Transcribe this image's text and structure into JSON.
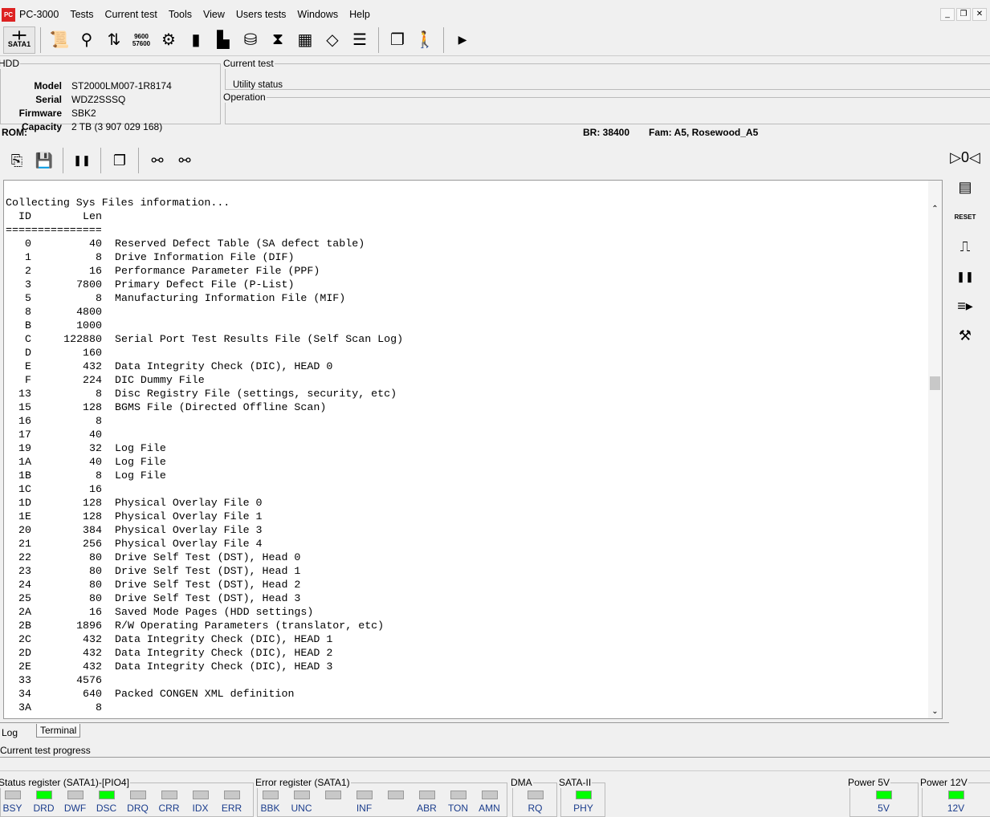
{
  "app": {
    "title": "PC-3000",
    "menu": [
      "PC-3000",
      "Tests",
      "Current test",
      "Tools",
      "View",
      "Users tests",
      "Windows",
      "Help"
    ]
  },
  "toolbar": {
    "sata_label": "SATA1",
    "icons": [
      "info-scroll-icon",
      "lightbulb-icon",
      "transfer-icon",
      "baud-rate-icon",
      "gear-disk-icon",
      "chip-icon",
      "board-icon",
      "cylinder-icon",
      "hourglass-icon",
      "grid-icon",
      "flowchart-icon",
      "list-icon",
      "windows-icon",
      "exit-icon",
      "more-icon"
    ],
    "baud_text": "9600 57600"
  },
  "hdd": {
    "legend": "HDD",
    "fields": [
      {
        "key": "Model",
        "value": "ST2000LM007-1R8174"
      },
      {
        "key": "Serial",
        "value": "WDZ2SSSQ"
      },
      {
        "key": "Firmware",
        "value": "SBK2"
      },
      {
        "key": "Capacity",
        "value": "2 TB (3 907 029 168)"
      }
    ]
  },
  "current_test": {
    "legend": "Current test",
    "status": "Utility status"
  },
  "operation": {
    "legend": "Operation"
  },
  "rom": {
    "label": "ROM:",
    "br": "BR: 38400",
    "fam": "Fam: A5, Rosewood_A5"
  },
  "log": {
    "header": "Collecting Sys Files information...",
    "col_id": "ID",
    "col_len": "Len",
    "separator": "===============",
    "rows": [
      {
        "id": "0",
        "len": "40",
        "desc": "Reserved Defect Table (SA defect table)"
      },
      {
        "id": "1",
        "len": "8",
        "desc": "Drive Information File (DIF)"
      },
      {
        "id": "2",
        "len": "16",
        "desc": "Performance Parameter File (PPF)"
      },
      {
        "id": "3",
        "len": "7800",
        "desc": "Primary Defect File (P-List)"
      },
      {
        "id": "5",
        "len": "8",
        "desc": "Manufacturing Information File (MIF)"
      },
      {
        "id": "8",
        "len": "4800",
        "desc": ""
      },
      {
        "id": "B",
        "len": "1000",
        "desc": ""
      },
      {
        "id": "C",
        "len": "122880",
        "desc": "Serial Port Test Results File (Self Scan Log)"
      },
      {
        "id": "D",
        "len": "160",
        "desc": ""
      },
      {
        "id": "E",
        "len": "432",
        "desc": "Data Integrity Check (DIC), HEAD 0"
      },
      {
        "id": "F",
        "len": "224",
        "desc": "DIC Dummy File"
      },
      {
        "id": "13",
        "len": "8",
        "desc": "Disc Registry File (settings, security, etc)"
      },
      {
        "id": "15",
        "len": "128",
        "desc": "BGMS File (Directed Offline Scan)"
      },
      {
        "id": "16",
        "len": "8",
        "desc": ""
      },
      {
        "id": "17",
        "len": "40",
        "desc": ""
      },
      {
        "id": "19",
        "len": "32",
        "desc": "Log File"
      },
      {
        "id": "1A",
        "len": "40",
        "desc": "Log File"
      },
      {
        "id": "1B",
        "len": "8",
        "desc": "Log File"
      },
      {
        "id": "1C",
        "len": "16",
        "desc": ""
      },
      {
        "id": "1D",
        "len": "128",
        "desc": "Physical Overlay File 0"
      },
      {
        "id": "1E",
        "len": "128",
        "desc": "Physical Overlay File 1"
      },
      {
        "id": "20",
        "len": "384",
        "desc": "Physical Overlay File 3"
      },
      {
        "id": "21",
        "len": "256",
        "desc": "Physical Overlay File 4"
      },
      {
        "id": "22",
        "len": "80",
        "desc": "Drive Self Test (DST), Head 0"
      },
      {
        "id": "23",
        "len": "80",
        "desc": "Drive Self Test (DST), Head 1"
      },
      {
        "id": "24",
        "len": "80",
        "desc": "Drive Self Test (DST), Head 2"
      },
      {
        "id": "25",
        "len": "80",
        "desc": "Drive Self Test (DST), Head 3"
      },
      {
        "id": "2A",
        "len": "16",
        "desc": "Saved Mode Pages (HDD settings)"
      },
      {
        "id": "2B",
        "len": "1896",
        "desc": "R/W Operating Parameters (translator, etc)"
      },
      {
        "id": "2C",
        "len": "432",
        "desc": "Data Integrity Check (DIC), HEAD 1"
      },
      {
        "id": "2D",
        "len": "432",
        "desc": "Data Integrity Check (DIC), HEAD 2"
      },
      {
        "id": "2E",
        "len": "432",
        "desc": "Data Integrity Check (DIC), HEAD 3"
      },
      {
        "id": "33",
        "len": "4576",
        "desc": ""
      },
      {
        "id": "34",
        "len": "640",
        "desc": "Packed CONGEN XML definition"
      },
      {
        "id": "3A",
        "len": "8",
        "desc": ""
      }
    ]
  },
  "tabs": [
    "Log",
    "Terminal"
  ],
  "progress": {
    "label": "Current test progress"
  },
  "status_register": {
    "legend": "Status register (SATA1)-[PIO4]",
    "leds": [
      {
        "l": "BSY",
        "on": false
      },
      {
        "l": "DRD",
        "on": true
      },
      {
        "l": "DWF",
        "on": false
      },
      {
        "l": "DSC",
        "on": true
      },
      {
        "l": "DRQ",
        "on": false
      },
      {
        "l": "CRR",
        "on": false
      },
      {
        "l": "IDX",
        "on": false
      },
      {
        "l": "ERR",
        "on": false
      }
    ]
  },
  "error_register": {
    "legend": "Error register (SATA1)",
    "leds": [
      {
        "l": "BBK",
        "on": false
      },
      {
        "l": "UNC",
        "on": false
      },
      {
        "l": "",
        "on": false
      },
      {
        "l": "INF",
        "on": false
      },
      {
        "l": "",
        "on": false
      },
      {
        "l": "ABR",
        "on": false
      },
      {
        "l": "TON",
        "on": false
      },
      {
        "l": "AMN",
        "on": false
      }
    ]
  },
  "dma": {
    "legend": "DMA",
    "leds": [
      {
        "l": "RQ",
        "on": false
      }
    ]
  },
  "sata2": {
    "legend": "SATA-II",
    "leds": [
      {
        "l": "PHY",
        "on": true
      }
    ]
  },
  "power5": {
    "legend": "Power 5V",
    "leds": [
      {
        "l": "5V",
        "on": true
      }
    ]
  },
  "power12": {
    "legend": "Power 12V",
    "leds": [
      {
        "l": "12V",
        "on": true
      }
    ]
  },
  "colors": {
    "led_on": "#00ff00",
    "led_off": "#c8c8c8",
    "led_label": "#1a3c8c"
  }
}
